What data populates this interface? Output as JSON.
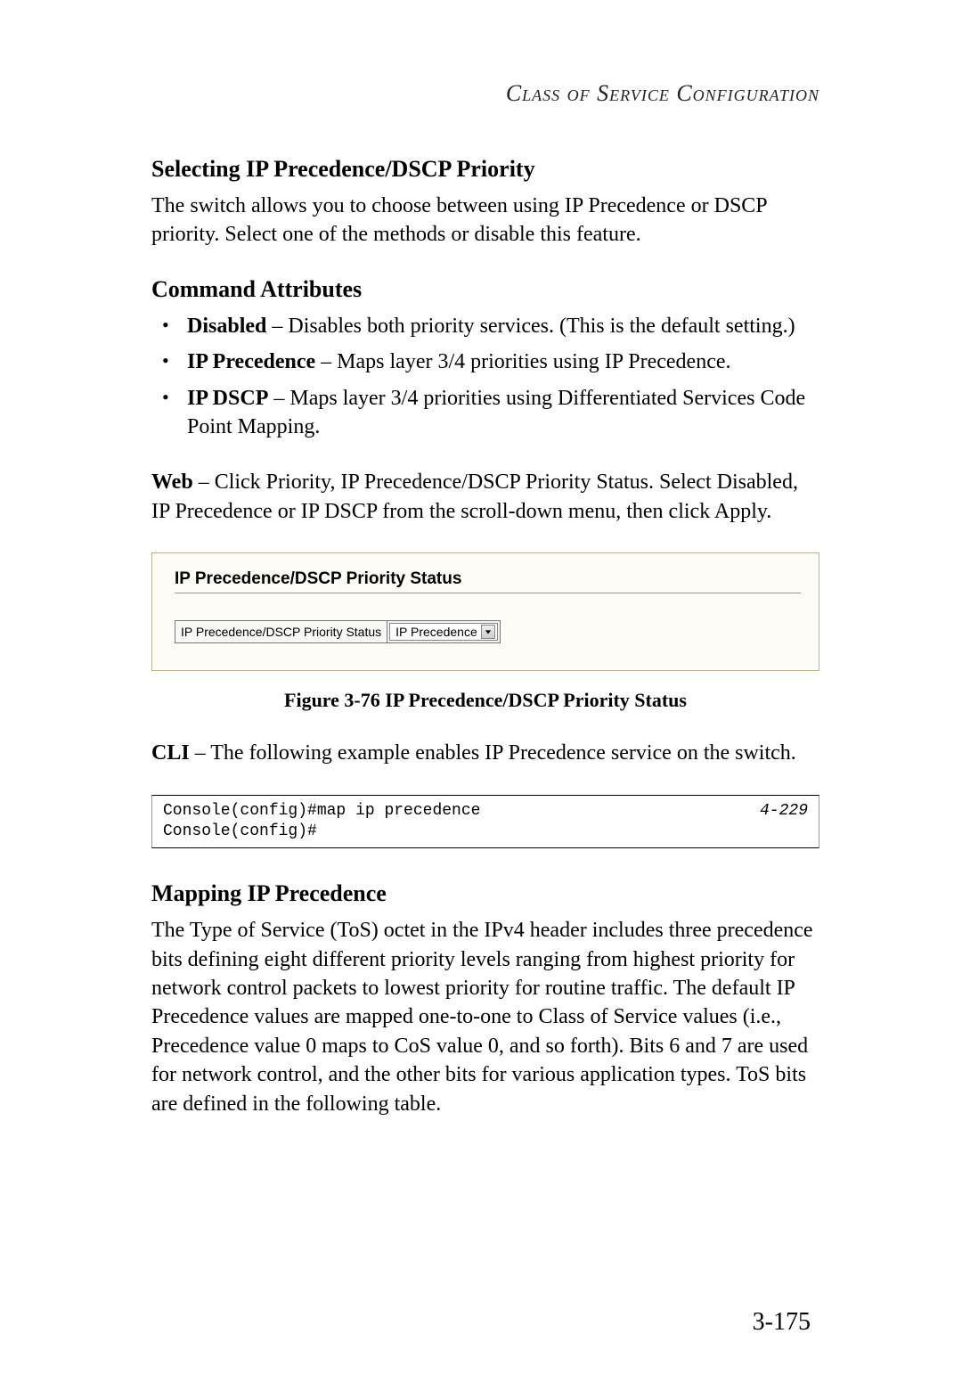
{
  "chapterHeader": "Class of Service Configuration",
  "section1": {
    "title": "Selecting IP Precedence/DSCP Priority",
    "intro": "The switch allows you to choose between using IP Precedence or DSCP priority. Select one of the methods or disable this feature."
  },
  "commandAttributes": {
    "heading": "Command Attributes",
    "items": [
      {
        "term": "Disabled",
        "desc": " – Disables both priority services. (This is the default setting.)"
      },
      {
        "term": "IP Precedence",
        "desc": " – Maps layer 3/4 priorities using IP Precedence."
      },
      {
        "term": "IP DSCP",
        "desc": " – Maps layer 3/4 priorities using Differentiated Services Code Point Mapping."
      }
    ]
  },
  "webInstruction": {
    "label": "Web",
    "text": " – Click Priority, IP Precedence/DSCP Priority Status. Select Disabled, IP Precedence or IP DSCP from the scroll-down menu, then click Apply."
  },
  "configPanel": {
    "title": "IP Precedence/DSCP Priority Status",
    "fieldLabel": "IP Precedence/DSCP Priority Status",
    "selectedValue": "IP Precedence"
  },
  "figureCaption": "Figure 3-76  IP Precedence/DSCP Priority Status",
  "cliInstruction": {
    "label": "CLI",
    "text": " – The following example enables IP Precedence service on the switch."
  },
  "cliBlock": {
    "lines": "Console(config)#map ip precedence\nConsole(config)#",
    "reference": "4-229"
  },
  "section2": {
    "title": "Mapping IP Precedence",
    "body": "The Type of Service (ToS) octet in the IPv4 header includes three precedence bits defining eight different priority levels ranging from highest priority for network control packets to lowest priority for routine traffic. The default IP Precedence values are mapped one-to-one to Class of Service values (i.e., Precedence value 0 maps to CoS value 0, and so forth). Bits 6 and 7 are used for network control, and the other bits for various application types. ToS bits are defined in the following table."
  },
  "pageNumber": "3-175"
}
